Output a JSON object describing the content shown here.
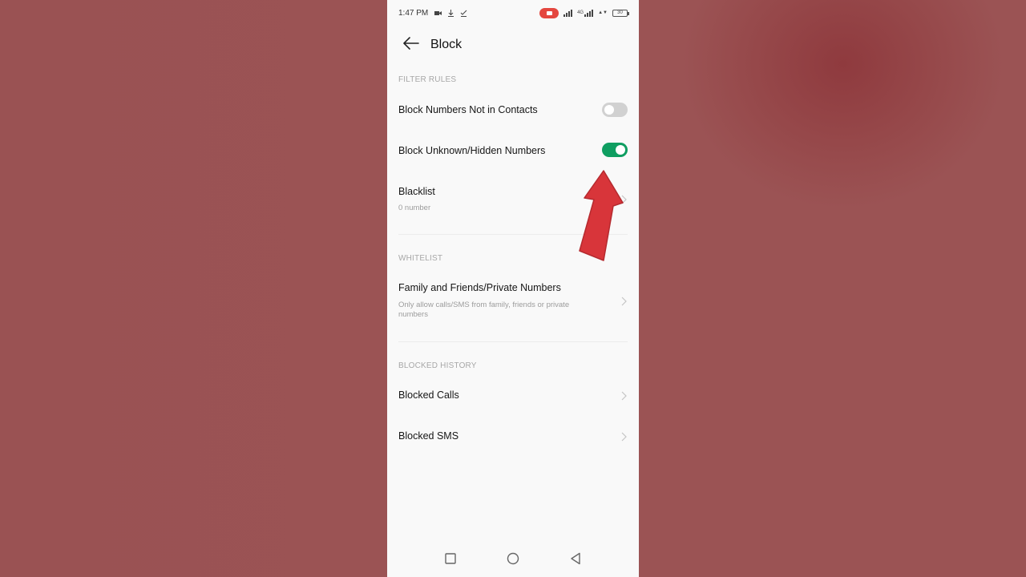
{
  "status_bar": {
    "time": "1:47 PM",
    "network_label": "4G",
    "battery_level": "30"
  },
  "header": {
    "title": "Block"
  },
  "sections": {
    "filter_rules": "FILTER RULES",
    "whitelist": "WHITELIST",
    "blocked_history": "BLOCKED HISTORY"
  },
  "filter_rules": {
    "block_not_in_contacts": {
      "label": "Block Numbers Not in Contacts",
      "enabled": false
    },
    "block_unknown_hidden": {
      "label": "Block Unknown/Hidden Numbers",
      "enabled": true
    },
    "blacklist": {
      "label": "Blacklist",
      "subtitle": "0 number"
    }
  },
  "whitelist": {
    "family_friends": {
      "label": "Family and Friends/Private Numbers",
      "subtitle": "Only allow calls/SMS from family, friends or private numbers"
    }
  },
  "blocked_history": {
    "calls": {
      "label": "Blocked Calls"
    },
    "sms": {
      "label": "Blocked SMS"
    }
  },
  "colors": {
    "toggle_on": "#0f9e61",
    "toggle_off": "#d1d1d1",
    "record_pill": "#e4473f",
    "annotation_arrow": "#d8353a",
    "backdrop": "#9a5152"
  },
  "icons": {
    "back": "arrow-left-icon",
    "chevron": "chevron-right-icon",
    "nav_recents": "square-icon",
    "nav_home": "circle-icon",
    "nav_back": "triangle-back-icon"
  }
}
